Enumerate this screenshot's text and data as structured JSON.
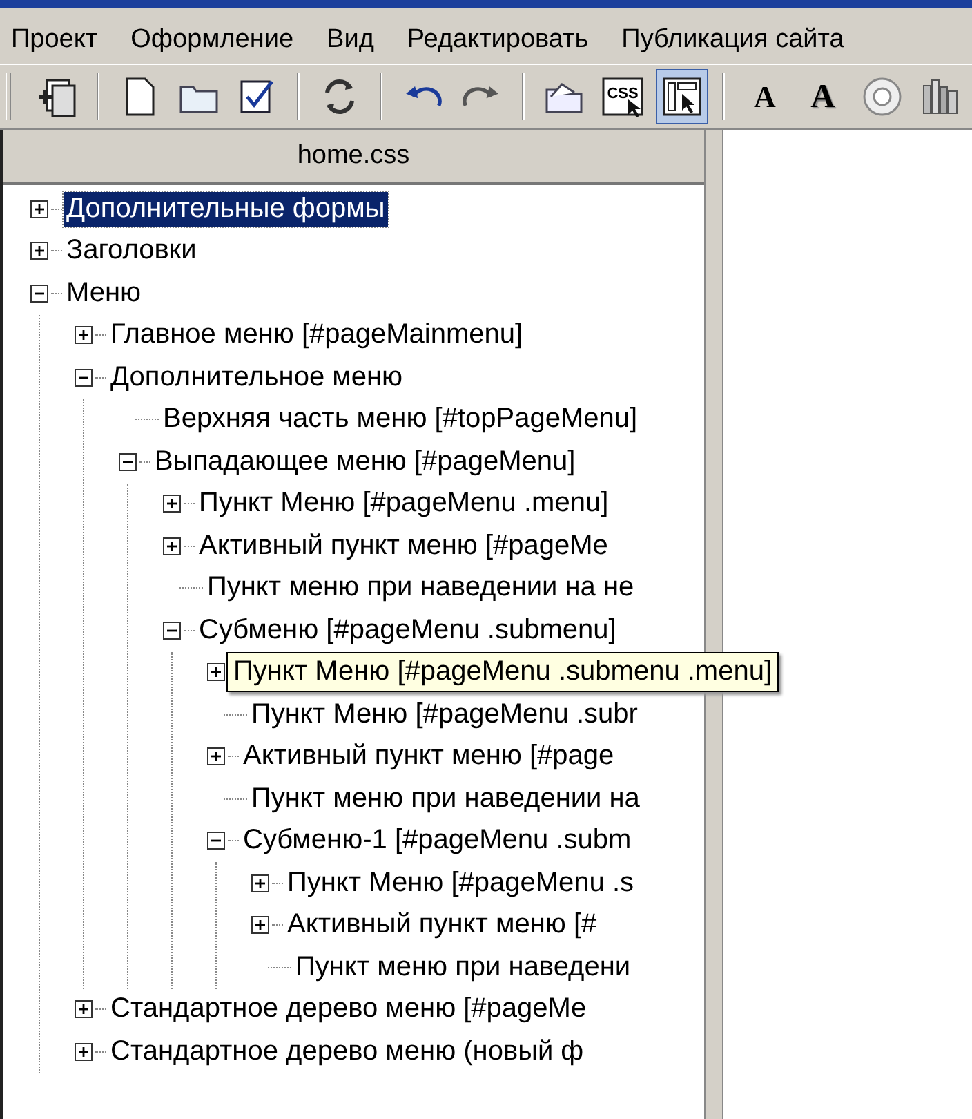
{
  "menubar": [
    "Проект",
    "Оформление",
    "Вид",
    "Редактировать",
    "Публикация сайта"
  ],
  "toolbar": [
    [
      {
        "kind": "import",
        "selected": false
      }
    ],
    [
      {
        "kind": "new",
        "selected": false
      },
      {
        "kind": "open",
        "selected": false
      },
      {
        "kind": "edit",
        "selected": false
      }
    ],
    [
      {
        "kind": "sync",
        "selected": false
      }
    ],
    [
      {
        "kind": "undo",
        "selected": false
      },
      {
        "kind": "redo",
        "selected": false
      }
    ],
    [
      {
        "kind": "folder",
        "selected": false
      },
      {
        "kind": "css",
        "label": "CSS",
        "selected": false
      },
      {
        "kind": "layout",
        "selected": true
      }
    ],
    [
      {
        "kind": "font",
        "label": "A",
        "selected": false
      },
      {
        "kind": "fontshadow",
        "label": "A",
        "selected": false
      },
      {
        "kind": "disc",
        "selected": false
      },
      {
        "kind": "library",
        "selected": false
      }
    ]
  ],
  "panel": {
    "title": "home.css",
    "tree": [
      {
        "label": "Дополнительные формы",
        "kind": "folder",
        "expanded": false,
        "selected": true
      },
      {
        "label": "Заголовки",
        "kind": "folder",
        "expanded": false,
        "selected": false
      },
      {
        "label": "Меню",
        "kind": "folder",
        "expanded": true,
        "selected": false,
        "children": [
          {
            "label": "Главное меню [#pageMainmenu]",
            "kind": "folder",
            "expanded": false,
            "selected": false
          },
          {
            "label": "Дополнительное меню",
            "kind": "folder",
            "expanded": true,
            "selected": false,
            "children": [
              {
                "label": "Верхняя часть меню [#topPageMenu]",
                "kind": "leaf",
                "selected": false
              },
              {
                "label": "Выпадающее меню  [#pageMenu]",
                "kind": "folder",
                "expanded": true,
                "selected": false,
                "children": [
                  {
                    "label": "Пункт Меню [#pageMenu .menu]",
                    "kind": "folder",
                    "expanded": false,
                    "selected": false
                  },
                  {
                    "label": "Активный пункт меню  [#pageMe",
                    "kind": "folder",
                    "expanded": false,
                    "selected": false
                  },
                  {
                    "label": "Пункт меню при наведении на не",
                    "kind": "leaf",
                    "selected": false
                  },
                  {
                    "label": "Субменю [#pageMenu .submenu]",
                    "kind": "folder",
                    "expanded": true,
                    "selected": false,
                    "children": [
                      {
                        "label": "Пункт Меню [#pageMenu .submenu .menu]",
                        "kind": "folder",
                        "expanded": false,
                        "selected": false,
                        "tooltip": true
                      },
                      {
                        "label": "Пункт Меню [#pageMenu .subr",
                        "kind": "leaf",
                        "selected": false
                      },
                      {
                        "label": "Активный пункт меню  [#page",
                        "kind": "folder",
                        "expanded": false,
                        "selected": false
                      },
                      {
                        "label": "Пункт меню при наведении на",
                        "kind": "leaf",
                        "selected": false
                      },
                      {
                        "label": "Субменю-1 [#pageMenu .subm",
                        "kind": "folder",
                        "expanded": true,
                        "selected": false,
                        "children": [
                          {
                            "label": "Пункт Меню [#pageMenu .s",
                            "kind": "folder",
                            "expanded": false,
                            "selected": false
                          },
                          {
                            "label": "Активный пункт меню  [#",
                            "kind": "folder",
                            "expanded": false,
                            "selected": false
                          },
                          {
                            "label": "Пункт меню при наведени",
                            "kind": "leaf",
                            "selected": false
                          }
                        ]
                      }
                    ]
                  }
                ]
              }
            ]
          },
          {
            "label": "Стандартное дерево меню  [#pageMe",
            "kind": "folder",
            "expanded": false,
            "selected": false
          },
          {
            "label": "Стандартное дерево меню (новый ф",
            "kind": "folder",
            "expanded": false,
            "selected": false
          }
        ]
      }
    ]
  }
}
